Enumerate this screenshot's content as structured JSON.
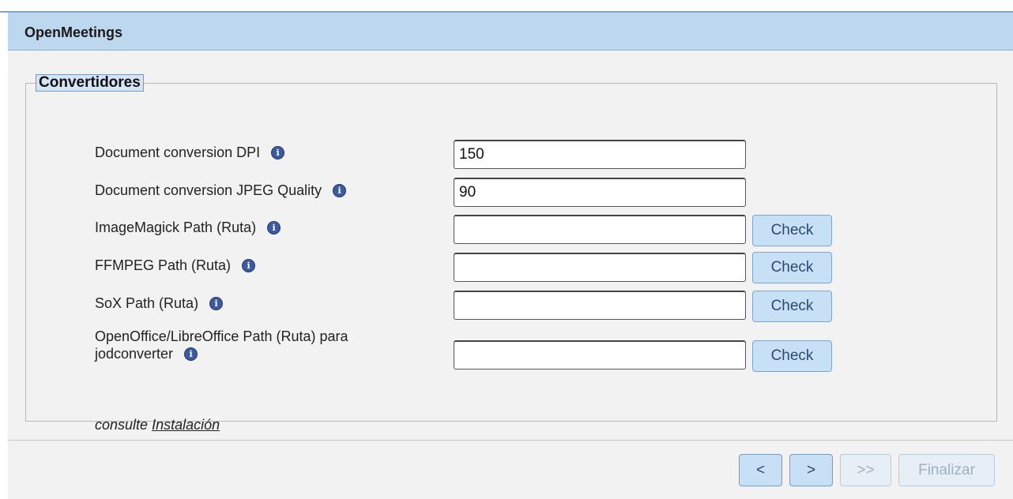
{
  "header": {
    "title": "OpenMeetings"
  },
  "section": {
    "legend": "Convertidores"
  },
  "fields": [
    {
      "label": "Document conversion DPI",
      "value": "150",
      "has_check": false
    },
    {
      "label": "Document conversion JPEG Quality",
      "value": "90",
      "has_check": false
    },
    {
      "label": "ImageMagick Path (Ruta)",
      "value": "",
      "has_check": true
    },
    {
      "label": "FFMPEG Path (Ruta)",
      "value": "",
      "has_check": true
    },
    {
      "label": "SoX Path (Ruta)",
      "value": "",
      "has_check": true
    },
    {
      "label_line1": "OpenOffice/LibreOffice Path (Ruta) para",
      "label_line2": "jodconverter",
      "value": "",
      "has_check": true
    }
  ],
  "check_label": "Check",
  "info_icon_glyph": "i",
  "help": {
    "prefix": "consulte",
    "link": "Instalación"
  },
  "nav": {
    "prev": "<",
    "next": ">",
    "last": ">>",
    "finish": "Finalizar"
  },
  "colors": {
    "header_bg": "#bdd7ee",
    "button_bg": "#c8e0f5",
    "info_icon": "#3d5a9c"
  }
}
